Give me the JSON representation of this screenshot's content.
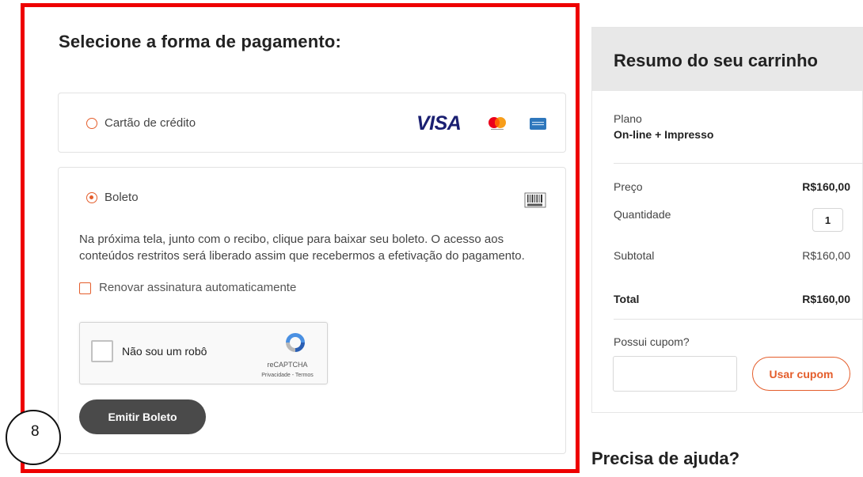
{
  "payment": {
    "title": "Selecione a forma de pagamento:",
    "credit_label": "Cartão de crédito",
    "visa_logo": "VISA",
    "boleto_label": "Boleto",
    "boleto_description": "Na próxima tela, junto com o recibo, clique para baixar seu boleto. O acesso aos conteúdos restritos será liberado assim que recebermos a efetivação do pagamento.",
    "renew_label": "Renovar assinatura automaticamente",
    "recaptcha_label": "Não sou um robô",
    "recaptcha_brand": "reCAPTCHA",
    "recaptcha_links": "Privacidade - Termos",
    "emit_button": "Emitir Boleto",
    "selected_method": "boleto"
  },
  "badge": {
    "number": "8"
  },
  "summary": {
    "title": "Resumo do seu carrinho",
    "plan_label": "Plano",
    "plan_value": "On-line + Impresso",
    "price_label": "Preço",
    "price_value": "R$160,00",
    "quantity_label": "Quantidade",
    "quantity_value": "1",
    "subtotal_label": "Subtotal",
    "subtotal_value": "R$160,00",
    "total_label": "Total",
    "total_value": "R$160,00",
    "coupon_label": "Possui cupom?",
    "coupon_placeholder": "",
    "coupon_button": "Usar cupom"
  },
  "help": {
    "title": "Precisa de ajuda?"
  },
  "colors": {
    "accent": "#e45d2b",
    "highlight": "#ee0000",
    "button_dark": "#4a4a4a",
    "summary_header": "#e8e8e8"
  },
  "icons": [
    "visa-icon",
    "mastercard-icon",
    "amex-icon",
    "barcode-icon",
    "recaptcha-icon"
  ]
}
